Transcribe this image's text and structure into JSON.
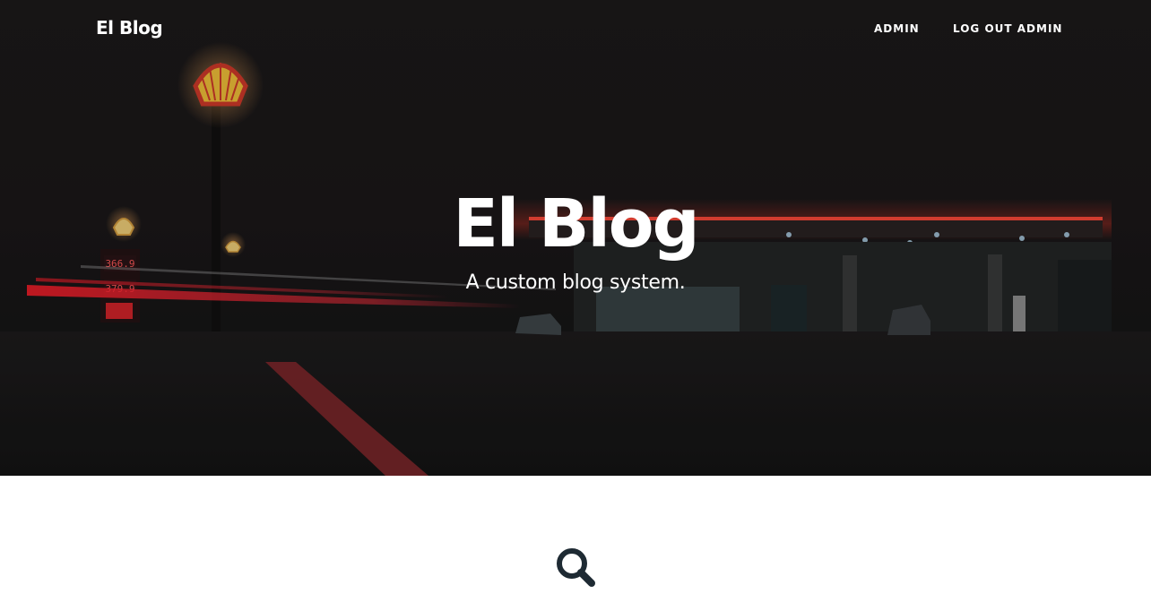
{
  "navbar": {
    "brand": "El Blog",
    "links": [
      {
        "label": "ADMIN"
      },
      {
        "label": "LOG OUT ADMIN"
      }
    ]
  },
  "hero": {
    "title": "El Blog",
    "subtitle": "A custom blog system.",
    "background": "night-gas-station-photo",
    "price_sign": {
      "top": "366.9",
      "middle": "379.9"
    }
  },
  "search": {
    "icon": "search-icon"
  },
  "colors": {
    "hero_overlay": "#1b1819",
    "neon_red": "#ff2a2a",
    "text": "#ffffff",
    "search_icon": "#1e2a33"
  }
}
